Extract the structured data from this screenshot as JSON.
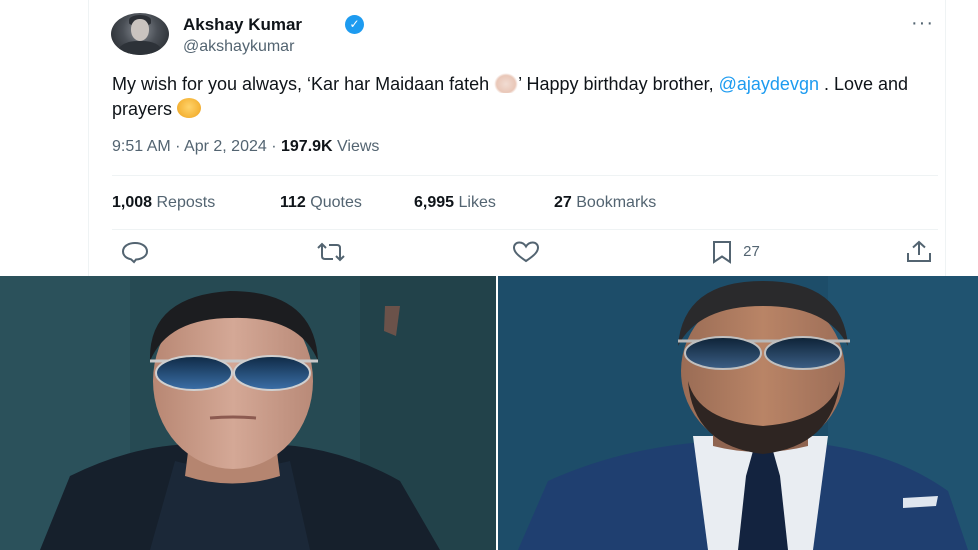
{
  "author": {
    "display_name": "Akshay Kumar",
    "handle": "@akshaykumar",
    "verified_icon": "verified-badge-icon",
    "verified_glyph": "✓"
  },
  "menu": {
    "more_glyph": "···"
  },
  "tweet": {
    "text_part1": "My wish for you always, ‘Kar har Maidaan fateh ",
    "text_part2": "’  Happy birthday brother, ",
    "mention": "@ajaydevgn",
    "text_part3": " . Love and prayers "
  },
  "meta": {
    "time": "9:51 AM",
    "separator": " · ",
    "date": "Apr 2, 2024",
    "views_count": "197.9K",
    "views_label": " Views"
  },
  "stats": {
    "reposts_count": "1,008",
    "reposts_label": " Reposts",
    "quotes_count": "112",
    "quotes_label": " Quotes",
    "likes_count": "6,995",
    "likes_label": " Likes",
    "bookmarks_count": "27",
    "bookmarks_label": " Bookmarks"
  },
  "actions": {
    "reply_icon": "reply-icon",
    "repost_icon": "repost-icon",
    "like_icon": "like-icon",
    "bookmark_icon": "bookmark-icon",
    "bookmark_count": "27",
    "share_icon": "share-icon"
  },
  "colors": {
    "accent": "#1d9bf0",
    "text_primary": "#0f1419",
    "text_secondary": "#536471",
    "divider": "#eff3f4"
  }
}
